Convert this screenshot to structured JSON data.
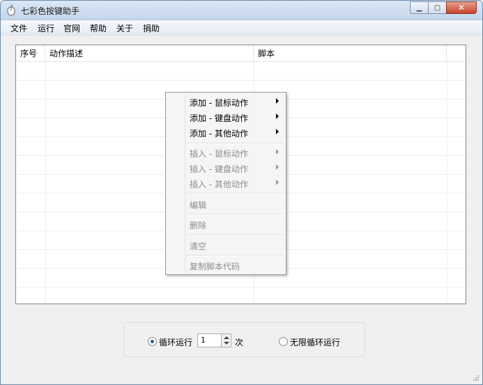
{
  "window": {
    "title": "七彩色按键助手"
  },
  "titlebar": {
    "minimize": "▁",
    "maximize": "▢",
    "close": "✕"
  },
  "menu": {
    "items": [
      "文件",
      "运行",
      "官网",
      "帮助",
      "关于",
      "捐助"
    ]
  },
  "list": {
    "columns": [
      "序号",
      "动作描述",
      "脚本"
    ]
  },
  "context_menu": {
    "add_mouse": "添加 - 鼠标动作",
    "add_keyboard": "添加 - 键盘动作",
    "add_other": "添加 - 其他动作",
    "insert_mouse": "插入 - 鼠标动作",
    "insert_keyboard": "插入 - 键盘动作",
    "insert_other": "插入 - 其他动作",
    "edit": "编辑",
    "delete": "删除",
    "clear": "清空",
    "copy_code": "复制脚本代码"
  },
  "run_options": {
    "loop_label": "循环运行",
    "loop_count": "1",
    "times_label": "次",
    "infinite_label": "无限循环运行",
    "selected": "loop"
  }
}
